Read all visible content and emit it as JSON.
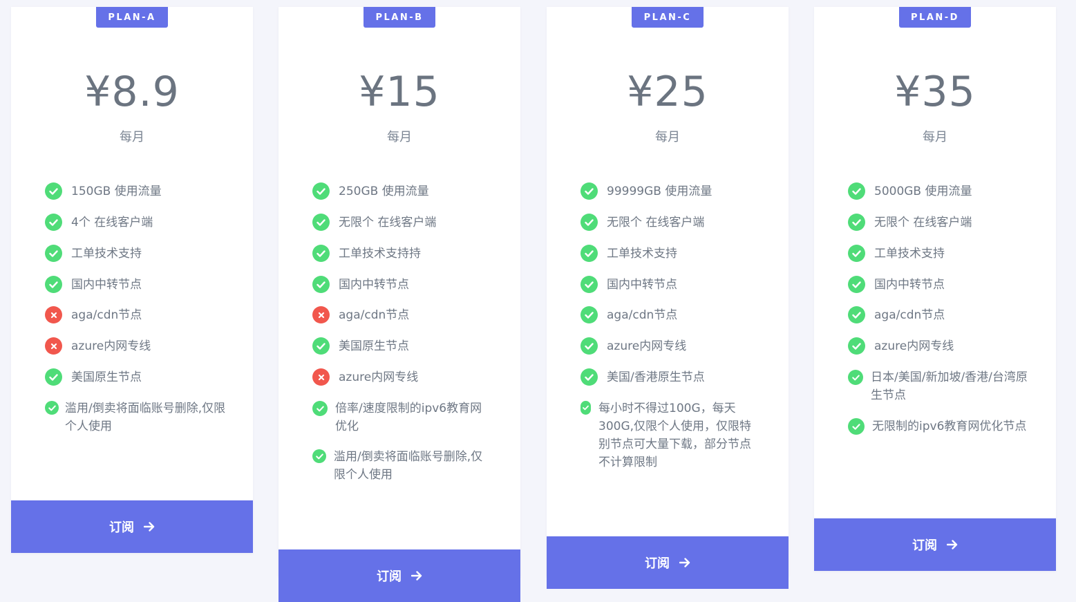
{
  "plans": [
    {
      "badge": "PLAN-A",
      "price": "¥8.9",
      "period": "每月",
      "features": [
        {
          "text": "150GB 使用流量",
          "status": "check"
        },
        {
          "text": "4个 在线客户端",
          "status": "check"
        },
        {
          "text": "工单技术支持",
          "status": "check"
        },
        {
          "text": "国内中转节点",
          "status": "check"
        },
        {
          "text": "aga/cdn节点",
          "status": "cross"
        },
        {
          "text": "azure内网专线",
          "status": "cross"
        },
        {
          "text": "美国原生节点",
          "status": "check"
        },
        {
          "text": "滥用/倒卖将面临账号删除,仅限个人使用",
          "status": "check"
        }
      ],
      "button": "订阅"
    },
    {
      "badge": "PLAN-B",
      "price": "¥15",
      "period": "每月",
      "features": [
        {
          "text": "250GB 使用流量",
          "status": "check"
        },
        {
          "text": "无限个 在线客户端",
          "status": "check"
        },
        {
          "text": "工单技术支持持",
          "status": "check"
        },
        {
          "text": "国内中转节点",
          "status": "check"
        },
        {
          "text": "aga/cdn节点",
          "status": "cross"
        },
        {
          "text": "美国原生节点",
          "status": "check"
        },
        {
          "text": "azure内网专线",
          "status": "cross"
        },
        {
          "text": "倍率/速度限制的ipv6教育网优化",
          "status": "check"
        },
        {
          "text": "滥用/倒卖将面临账号删除,仅限个人使用",
          "status": "check"
        }
      ],
      "button": "订阅"
    },
    {
      "badge": "PLAN-C",
      "price": "¥25",
      "period": "每月",
      "features": [
        {
          "text": "99999GB 使用流量",
          "status": "check"
        },
        {
          "text": "无限个 在线客户端",
          "status": "check"
        },
        {
          "text": "工单技术支持",
          "status": "check"
        },
        {
          "text": "国内中转节点",
          "status": "check"
        },
        {
          "text": "aga/cdn节点",
          "status": "check"
        },
        {
          "text": "azure内网专线",
          "status": "check"
        },
        {
          "text": "美国/香港原生节点",
          "status": "check"
        },
        {
          "text": "每小时不得过100G，每天300G,仅限个人使用，仅限特别节点可大量下载，部分节点不计算限制",
          "status": "check"
        }
      ],
      "button": "订阅"
    },
    {
      "badge": "PLAN-D",
      "price": "¥35",
      "period": "每月",
      "features": [
        {
          "text": "5000GB 使用流量",
          "status": "check"
        },
        {
          "text": "无限个 在线客户端",
          "status": "check"
        },
        {
          "text": "工单技术支持",
          "status": "check"
        },
        {
          "text": "国内中转节点",
          "status": "check"
        },
        {
          "text": "aga/cdn节点",
          "status": "check"
        },
        {
          "text": "azure内网专线",
          "status": "check"
        },
        {
          "text": "日本/美国/新加坡/香港/台湾原生节点",
          "status": "check"
        },
        {
          "text": "无限制的ipv6教育网优化节点",
          "status": "check"
        }
      ],
      "button": "订阅"
    }
  ],
  "colors": {
    "accent": "#6571e8",
    "check": "#4fdc78",
    "cross": "#f1574d"
  },
  "icons": {
    "check": "check-icon",
    "cross": "cross-icon",
    "arrow": "arrow-right-icon"
  }
}
